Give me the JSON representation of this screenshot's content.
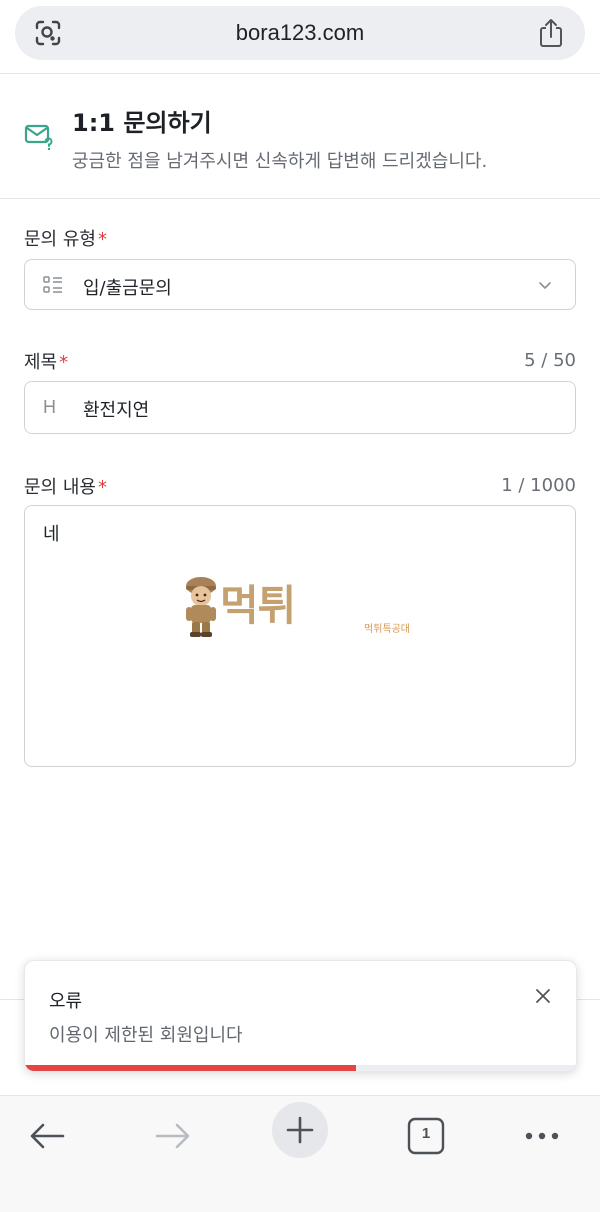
{
  "browser": {
    "url": "bora123.com",
    "tab_count": "1"
  },
  "header": {
    "title": "1:1 문의하기",
    "subtitle": "궁금한 점을 남겨주시면 신속하게 답변해 드리겠습니다."
  },
  "form": {
    "inquiry_type": {
      "label": "문의 유형",
      "required_mark": "*",
      "value": "입/출금문의"
    },
    "subject": {
      "label": "제목",
      "required_mark": "*",
      "counter": "5 / 50",
      "icon_letter": "H",
      "value": "환전지연"
    },
    "content": {
      "label": "문의 내용",
      "required_mark": "*",
      "counter": "1 / 1000",
      "value": "네"
    }
  },
  "watermark": {
    "text": "먹튀",
    "small": "먹튀특공대"
  },
  "toast": {
    "title": "오류",
    "message": "이용이 제한된 회원입니다",
    "progress": 0.6,
    "bar_color": "#e34543"
  },
  "icons": {
    "url_left": "visual-lookup-icon",
    "url_right": "share-icon",
    "header": "mail-question-icon",
    "select": "list-icon",
    "select_right": "chevron-down-icon",
    "toast_close": "close-icon",
    "toolbar": [
      "back-arrow-icon",
      "forward-arrow-icon",
      "plus-icon",
      "tabs-icon",
      "more-icon"
    ]
  },
  "colors": {
    "accent": "#3aa58a",
    "required": "#e0393e"
  }
}
